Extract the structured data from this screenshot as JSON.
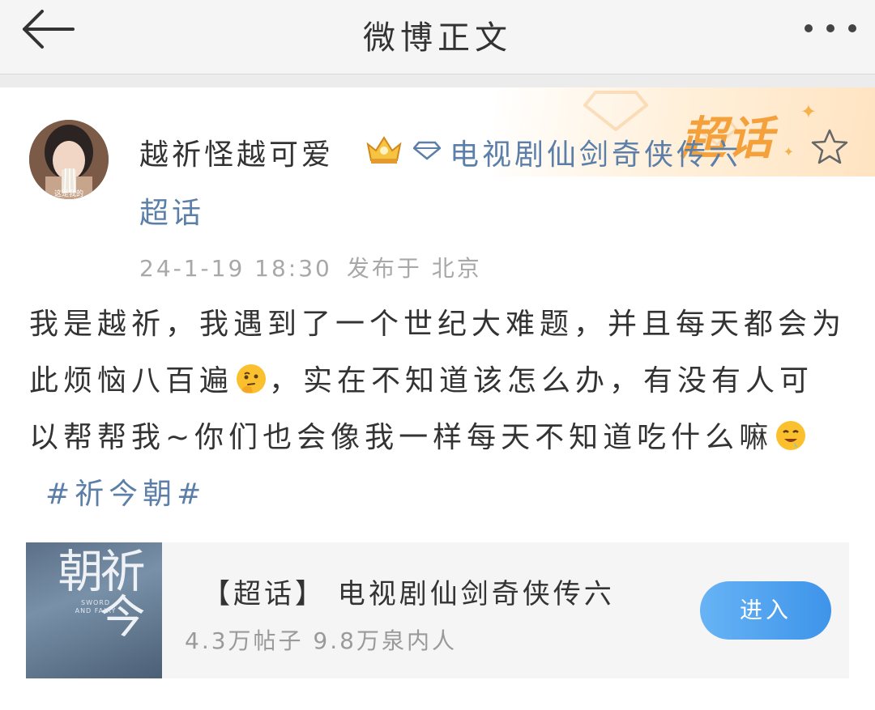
{
  "nav": {
    "title": "微博正文",
    "back_icon": "arrow-left-icon",
    "more_icon": "more-dots-icon"
  },
  "post": {
    "author": {
      "name": "越祈怪越可爱",
      "avatar_caption": "这是我的",
      "badge_icon": "crown-vip-icon"
    },
    "topic": {
      "icon": "diamond-icon",
      "line1": "电视剧仙剑奇侠传六",
      "line2": "超话"
    },
    "banner_text": "超话",
    "favorite_icon": "star-outline-icon",
    "meta": {
      "time": "24-1-19 18:30",
      "location": "发布于 北京"
    },
    "content": {
      "part1": "我是越祈，我遇到了一个世纪大难题，并且每天都会为此烦恼八百遍",
      "emoji1": "thinking-face-emoji",
      "part2": "，实在不知道该怎么办，有没有人可以帮帮我~你们也会像我一样每天不知道吃什么嘛",
      "emoji2": "drooling-face-emoji",
      "hashtag": "#祈今朝#"
    }
  },
  "topic_card": {
    "thumb_title": "祈今朝",
    "thumb_subtitle": "SWORD AND FAIRY",
    "title": "【超话】 电视剧仙剑奇侠传六",
    "stats": "4.3万帖子 9.8万泉内人",
    "button_label": "进入"
  },
  "colors": {
    "link_blue": "#5b7fa8",
    "button_blue": "#3e94ea",
    "chaohua_orange": "#f4a13c",
    "text_dark": "#333333",
    "meta_gray": "#a8a8a8"
  }
}
